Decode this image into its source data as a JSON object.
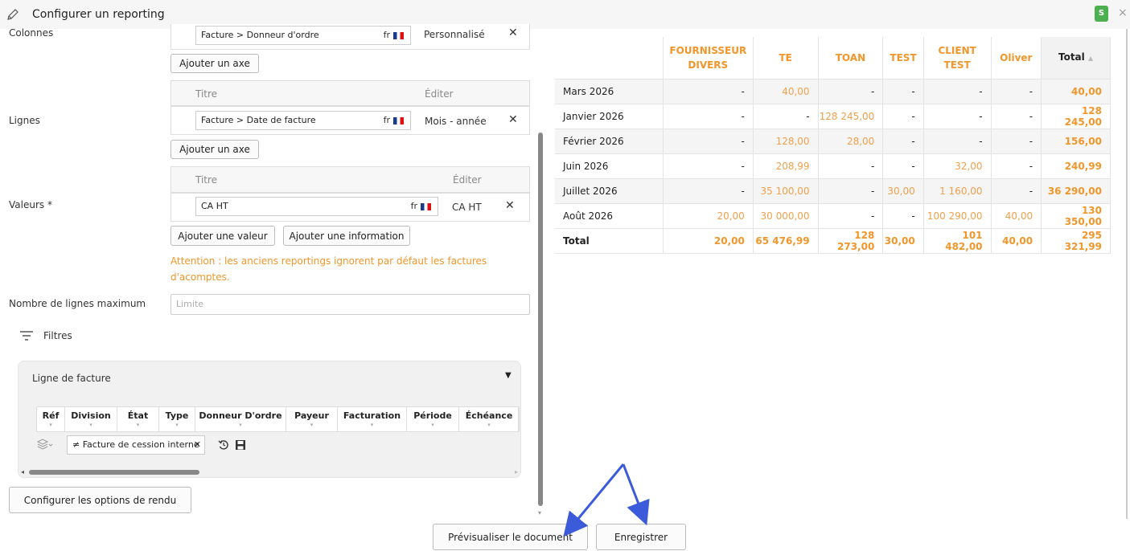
{
  "header": {
    "title": "Configurer un reporting",
    "user_initial": "S",
    "close": "×"
  },
  "sections": {
    "colonnes": "Colonnes",
    "lignes": "Lignes",
    "valeurs": "Valeurs *",
    "max_lines": "Nombre de lignes maximum",
    "filtres": "Filtres"
  },
  "columns_row": {
    "field": "Facture > Donneur d'ordre",
    "lang": "fr",
    "mode": "Personnalisé"
  },
  "table_headers": {
    "titre": "Titre",
    "editer": "Éditer"
  },
  "lines_row": {
    "field": "Facture > Date de facture",
    "lang": "fr",
    "mode": "Mois - année"
  },
  "values_row": {
    "field": "CA HT",
    "lang": "fr",
    "mode": "CA HT"
  },
  "buttons": {
    "add_axis": "Ajouter un axe",
    "add_value": "Ajouter une valeur",
    "add_info": "Ajouter une information",
    "render_options": "Configurer les options de rendu",
    "preview": "Prévisualiser le document",
    "save": "Enregistrer"
  },
  "warning": "Attention : les anciens reportings ignorent par défaut les factures d'acomptes.",
  "limit_placeholder": "Limite",
  "filter_panel": {
    "title": "Ligne de facture",
    "columns": [
      "Réf",
      "Division",
      "État",
      "Type",
      "Donneur D'ordre",
      "Payeur",
      "Facturation",
      "Période",
      "Échéance"
    ],
    "chip": "≠ Facture de cession interne"
  },
  "report": {
    "headers": [
      "FOURNISSEUR DIVERS",
      "TE",
      "TOAN",
      "TEST",
      "CLIENT TEST",
      "Oliver",
      "Total"
    ],
    "rows": [
      {
        "label": "Mars 2026",
        "cells": [
          "-",
          "40,00",
          "-",
          "-",
          "-",
          "-"
        ],
        "total": "40,00"
      },
      {
        "label": "Janvier 2026",
        "cells": [
          "-",
          "-",
          "128 245,00",
          "-",
          "-",
          "-"
        ],
        "total": "128 245,00"
      },
      {
        "label": "Février 2026",
        "cells": [
          "-",
          "128,00",
          "28,00",
          "-",
          "-",
          "-"
        ],
        "total": "156,00"
      },
      {
        "label": "Juin 2026",
        "cells": [
          "-",
          "208,99",
          "-",
          "-",
          "32,00",
          "-"
        ],
        "total": "240,99"
      },
      {
        "label": "Juillet 2026",
        "cells": [
          "-",
          "35 100,00",
          "-",
          "30,00",
          "1 160,00",
          "-"
        ],
        "total": "36 290,00"
      },
      {
        "label": "Août 2026",
        "cells": [
          "20,00",
          "30 000,00",
          "-",
          "-",
          "100 290,00",
          "40,00"
        ],
        "total": "130 350,00"
      }
    ],
    "total_row": {
      "label": "Total",
      "cells": [
        "20,00",
        "65 476,99",
        "128 273,00",
        "30,00",
        "101 482,00",
        "40,00"
      ],
      "total": "295 321,99"
    }
  },
  "colors": {
    "accent": "#f0962a",
    "user_badge": "#4caf50",
    "arrow": "#3b5bdb"
  }
}
